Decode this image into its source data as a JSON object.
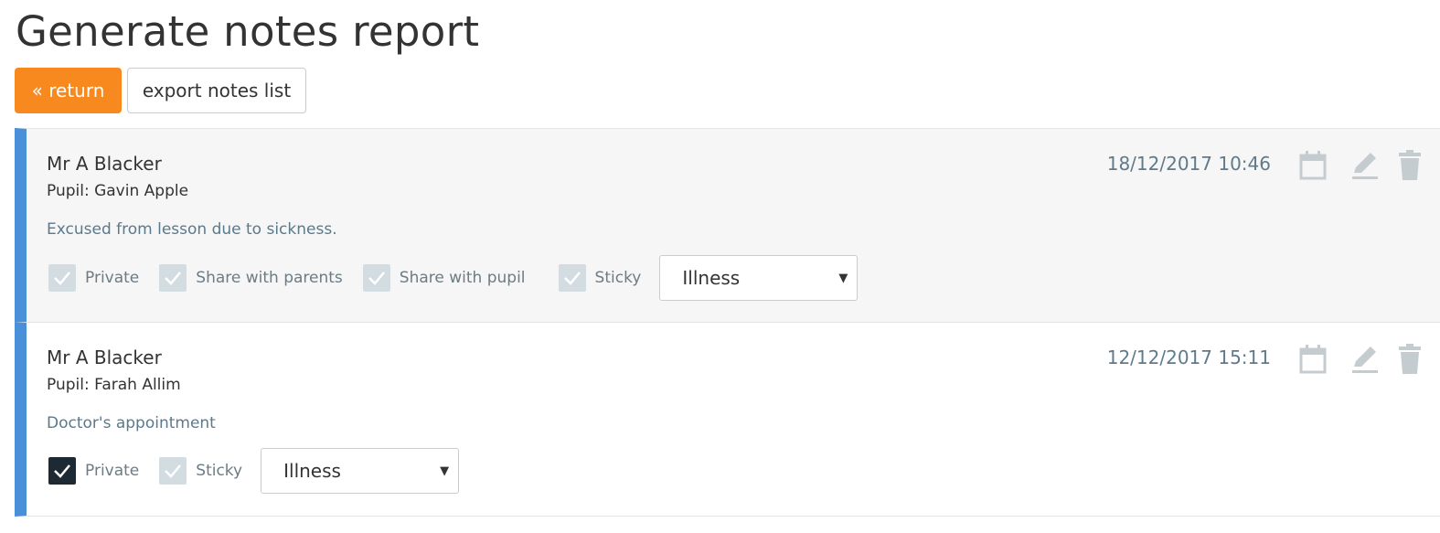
{
  "page": {
    "title": "Generate notes report"
  },
  "toolbar": {
    "return_label": "« return",
    "export_label": "export notes list"
  },
  "colors": {
    "accent_orange": "#f7891f",
    "note_border_blue": "#4a90d9",
    "checkbox_checked": "#1e2a33",
    "checkbox_unchecked": "#d3dde1"
  },
  "notes": [
    {
      "author": "Mr A Blacker",
      "pupil": "Pupil: Gavin Apple",
      "text": "Excused from lesson due to sickness.",
      "datetime": "18/12/2017 10:46",
      "options": [
        {
          "label": "Private",
          "checked": false
        },
        {
          "label": "Share with parents",
          "checked": false
        },
        {
          "label": "Share with pupil",
          "checked": false
        },
        {
          "label": "Sticky",
          "checked": false
        }
      ],
      "category": "Illness"
    },
    {
      "author": "Mr A Blacker",
      "pupil": "Pupil: Farah Allim",
      "text": "Doctor's appointment",
      "datetime": "12/12/2017 15:11",
      "options": [
        {
          "label": "Private",
          "checked": true
        },
        {
          "label": "Sticky",
          "checked": false
        }
      ],
      "category": "Illness"
    }
  ],
  "icons": {
    "calendar": "calendar-icon",
    "edit": "pencil-icon",
    "delete": "trash-icon",
    "check": "checkmark-icon",
    "caret": "caret-down-icon"
  }
}
